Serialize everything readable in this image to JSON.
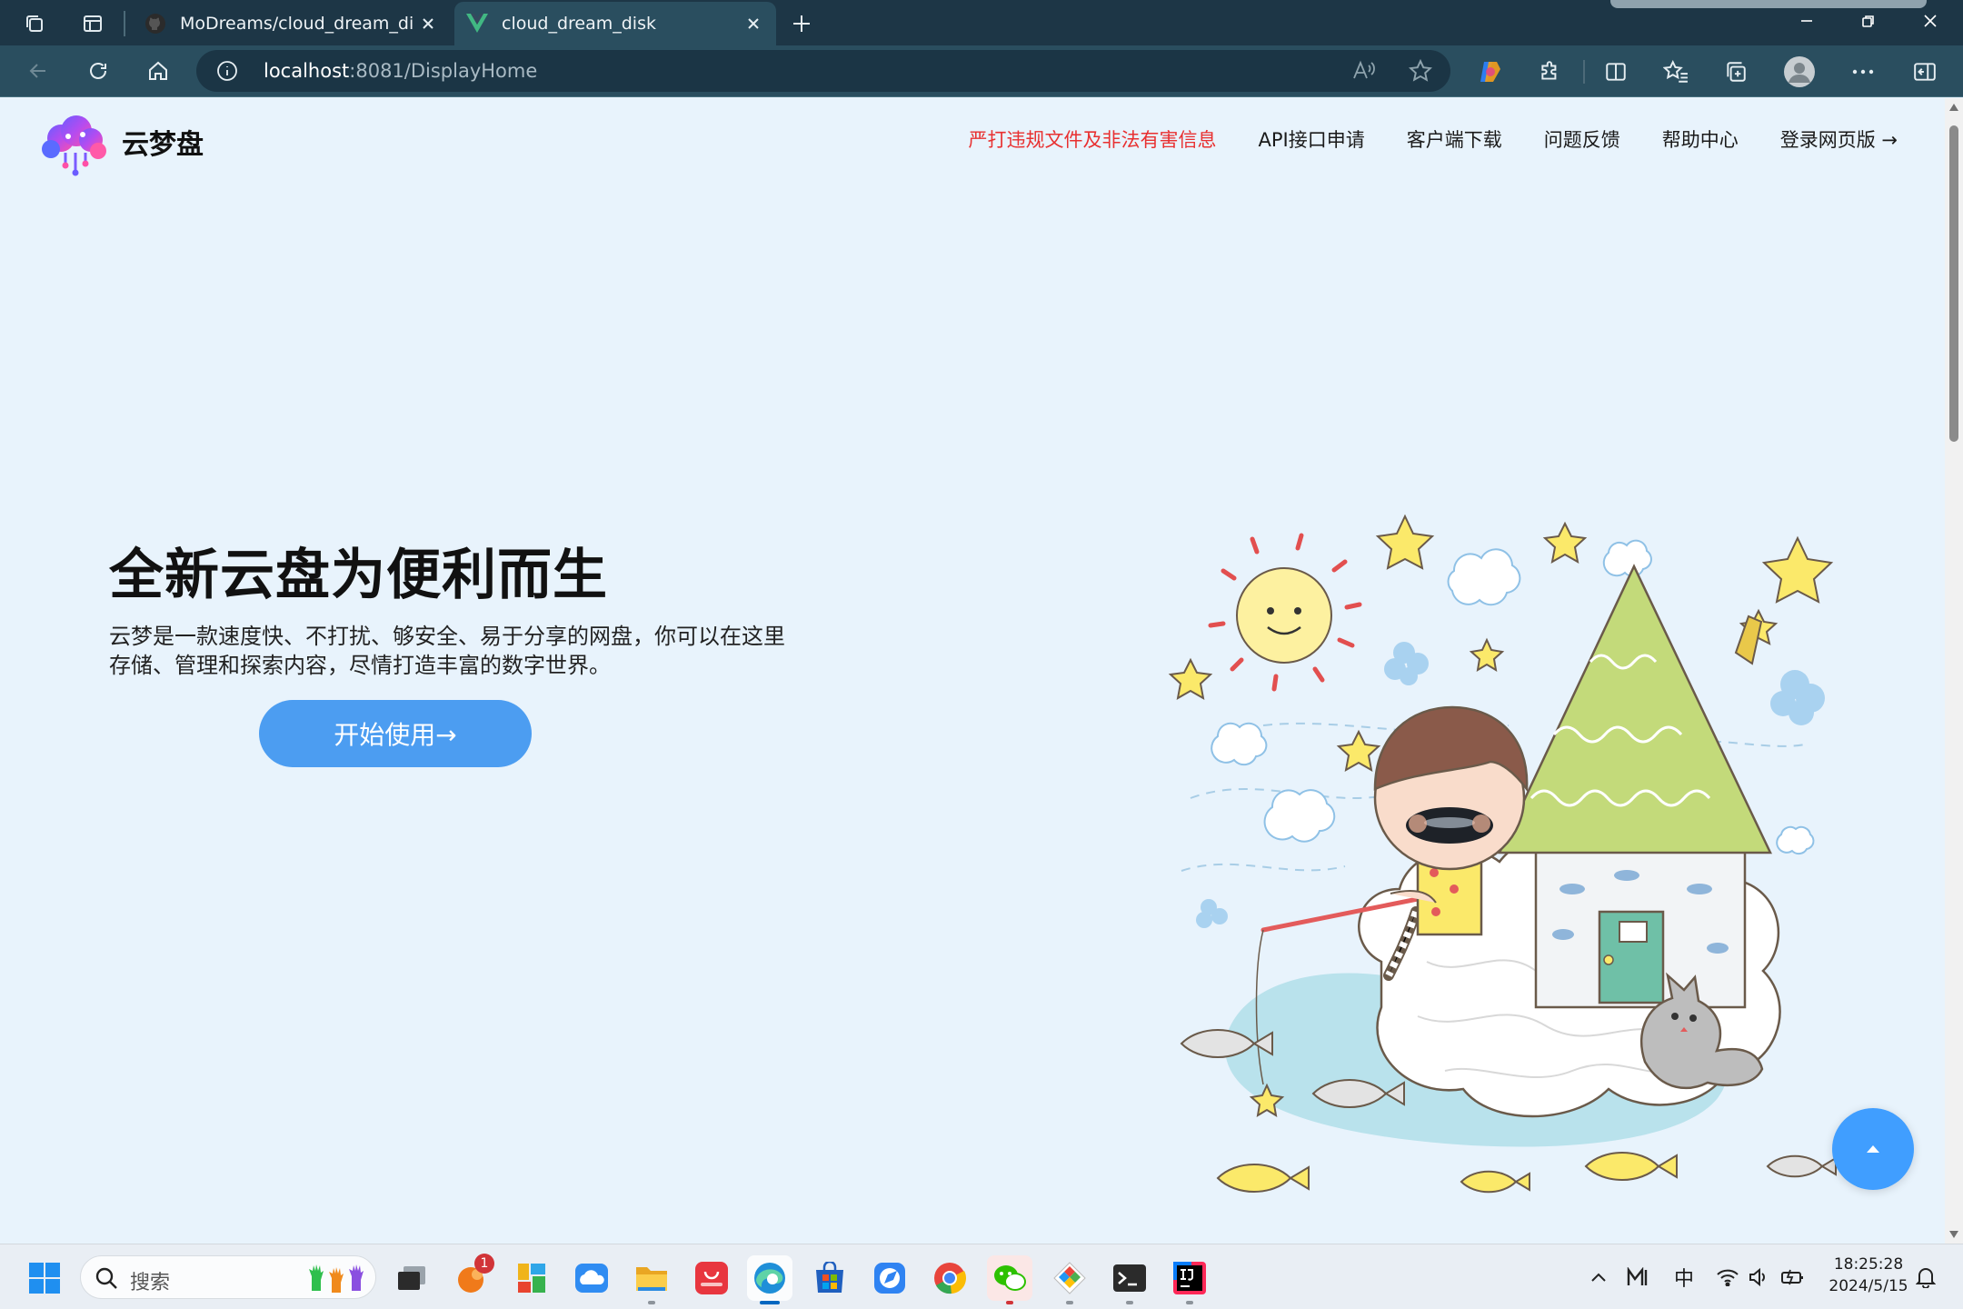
{
  "browser": {
    "tabs": [
      {
        "title": "MoDreams/cloud_dream_disk: —",
        "icon": "github-icon"
      },
      {
        "title": "cloud_dream_disk",
        "icon": "vue-icon"
      }
    ],
    "url_host": "localhost",
    "url_rest": ":8081/DisplayHome"
  },
  "site": {
    "brand": "云梦盘",
    "nav": {
      "warning": "严打违规文件及非法有害信息",
      "api": "API接口申请",
      "client": "客户端下载",
      "feedback": "问题反馈",
      "help": "帮助中心",
      "login": "登录网页版 →"
    },
    "hero": {
      "title": "全新云盘为便利而生",
      "desc_line1": "云梦是一款速度快、不打扰、够安全、易于分享的网盘，你可以在这里",
      "desc_line2": "存储、管理和探索内容，尽情打造丰富的数字世界。",
      "cta": "开始使用→"
    },
    "colors": {
      "accent": "#409eff",
      "warning": "#e83030",
      "background": "#e8f3fc"
    }
  },
  "taskbar": {
    "search_placeholder": "搜索",
    "notification_count": "1",
    "ime": "中",
    "time": "18:25:28",
    "date": "2024/5/15"
  }
}
